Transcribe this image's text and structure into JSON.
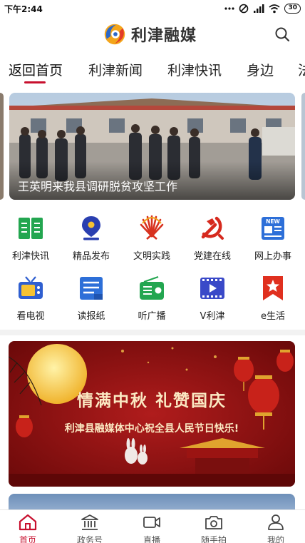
{
  "status_bar": {
    "time": "下午2:44",
    "battery": "30"
  },
  "header": {
    "app_title": "利津融媒"
  },
  "tabs": [
    {
      "label": "返回首页"
    },
    {
      "label": "利津新闻"
    },
    {
      "label": "利津快讯"
    },
    {
      "label": "身边"
    },
    {
      "label": "法"
    }
  ],
  "carousel": {
    "caption": "王英明来我县调研脱贫攻坚工作"
  },
  "grid": [
    {
      "label": "利津快讯",
      "icon": "book-icon",
      "color": "#23a650"
    },
    {
      "label": "精品发布",
      "icon": "pen-nib-icon",
      "color": "#2a3fb0"
    },
    {
      "label": "文明实践",
      "icon": "fan-emblem-icon",
      "color": "#d8321f"
    },
    {
      "label": "党建在线",
      "icon": "party-emblem-icon",
      "color": "#d62a1e"
    },
    {
      "label": "网上办事",
      "icon": "new-document-icon",
      "color": "#2d6fd8"
    },
    {
      "label": "看电视",
      "icon": "tv-icon",
      "color": "#2f5fd0"
    },
    {
      "label": "读报纸",
      "icon": "newspaper-icon",
      "color": "#2d6fd8"
    },
    {
      "label": "听广播",
      "icon": "radio-icon",
      "color": "#23a650"
    },
    {
      "label": "V利津",
      "icon": "video-icon",
      "color": "#3a49c8"
    },
    {
      "label": "e生活",
      "icon": "bookmark-star-icon",
      "color": "#e0301f"
    }
  ],
  "promo": {
    "title": "情满中秋 礼赞国庆",
    "subtitle": "利津县融媒体中心祝全县人民节日快乐!"
  },
  "bottom_nav": [
    {
      "label": "首页",
      "icon": "home-icon",
      "active": true
    },
    {
      "label": "政务号",
      "icon": "government-building-icon",
      "active": false
    },
    {
      "label": "直播",
      "icon": "video-camera-icon",
      "active": false
    },
    {
      "label": "随手拍",
      "icon": "camera-icon",
      "active": false
    },
    {
      "label": "我的",
      "icon": "user-icon",
      "active": false
    }
  ],
  "colors": {
    "accent": "#c8102e"
  }
}
